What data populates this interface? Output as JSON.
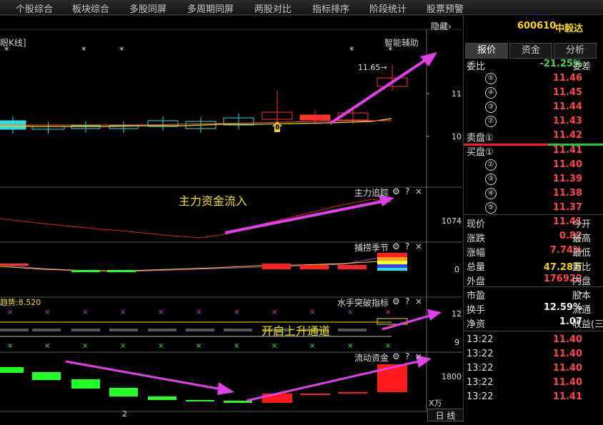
{
  "nav": [
    "个股综合",
    "板块综合",
    "多股同屏",
    "多周期同屏",
    "两股对比",
    "指标排序",
    "阶段统计",
    "股票预警"
  ],
  "hide_label": "隐藏",
  "hide_arrow": "›",
  "main_chart": {
    "title": "眼K线]",
    "assist": "智能辅助",
    "price_tag": "11.65→",
    "y_ticks": [
      "11",
      "10"
    ],
    "star": "*",
    "marker_b": "B"
  },
  "panel1": {
    "name": "主力追踪",
    "annotation": "主力资金流入",
    "tick": "1074"
  },
  "panel2": {
    "name": "捕捞季节",
    "tick": "0"
  },
  "panel3": {
    "name": "水手突破指标",
    "left_label": "趋势:8.520",
    "annotation": "开启上升通道",
    "ticks": [
      "12",
      "9"
    ],
    "x_mark": "×"
  },
  "panel4": {
    "name": "流动资金",
    "tick": "1800",
    "unit": "X万"
  },
  "controls": {
    "gear": "⚙",
    "help": "?",
    "close": "×"
  },
  "bottom": {
    "page": "2",
    "period": "日 线"
  },
  "stock": {
    "code": "600610",
    "name": "中毅达"
  },
  "tabs": [
    "报价",
    "资金",
    "分析"
  ],
  "weibi": {
    "label": "委比",
    "value": "-21.25%",
    "right": "委差"
  },
  "sell_label": "卖盘①",
  "buy_label": "买盘①",
  "asks": [
    {
      "n": "⑤",
      "p": "11.46"
    },
    {
      "n": "④",
      "p": "11.45"
    },
    {
      "n": "③",
      "p": "11.44"
    },
    {
      "n": "②",
      "p": "11.43"
    },
    {
      "n": "①",
      "p": "11.42"
    }
  ],
  "bids": [
    {
      "n": "①",
      "p": "11.41"
    },
    {
      "n": "②",
      "p": "11.40"
    },
    {
      "n": "③",
      "p": "11.39"
    },
    {
      "n": "④",
      "p": "11.38"
    },
    {
      "n": "⑤",
      "p": "11.37"
    }
  ],
  "quote": [
    {
      "k": "现价",
      "v": "11.41",
      "r": "今开",
      "cls": "red"
    },
    {
      "k": "涨跌",
      "v": "0.82",
      "r": "最高",
      "cls": "red"
    },
    {
      "k": "涨幅",
      "v": "7.74%",
      "r": "最低",
      "cls": "red"
    },
    {
      "k": "总量",
      "v": "47.28万",
      "r": "量比",
      "cls": "yel"
    },
    {
      "k": "外盘",
      "v": "176922",
      "r": "内盘",
      "cls": "red"
    }
  ],
  "info": [
    {
      "k": "市盈",
      "v": "-",
      "r": "股本",
      "cls": "white"
    },
    {
      "k": "换手",
      "v": "12.59%",
      "r": "流通",
      "cls": "white"
    },
    {
      "k": "净资",
      "v": "1.07",
      "r": "收益(三",
      "cls": "white"
    }
  ],
  "ticks_list": [
    {
      "t": "13:22",
      "p": "11.40"
    },
    {
      "t": "13:22",
      "p": "11.40"
    },
    {
      "t": "13:22",
      "p": "11.40"
    },
    {
      "t": "13:22",
      "p": "11.40"
    },
    {
      "t": "13:22",
      "p": "11.41"
    }
  ],
  "colors": {
    "up": "#ff3030",
    "down": "#2be0e0",
    "flow_up": "#ff1a1a",
    "flow_down": "#22ff22",
    "arrow": "#e040e8",
    "ma": "#f0e000"
  }
}
